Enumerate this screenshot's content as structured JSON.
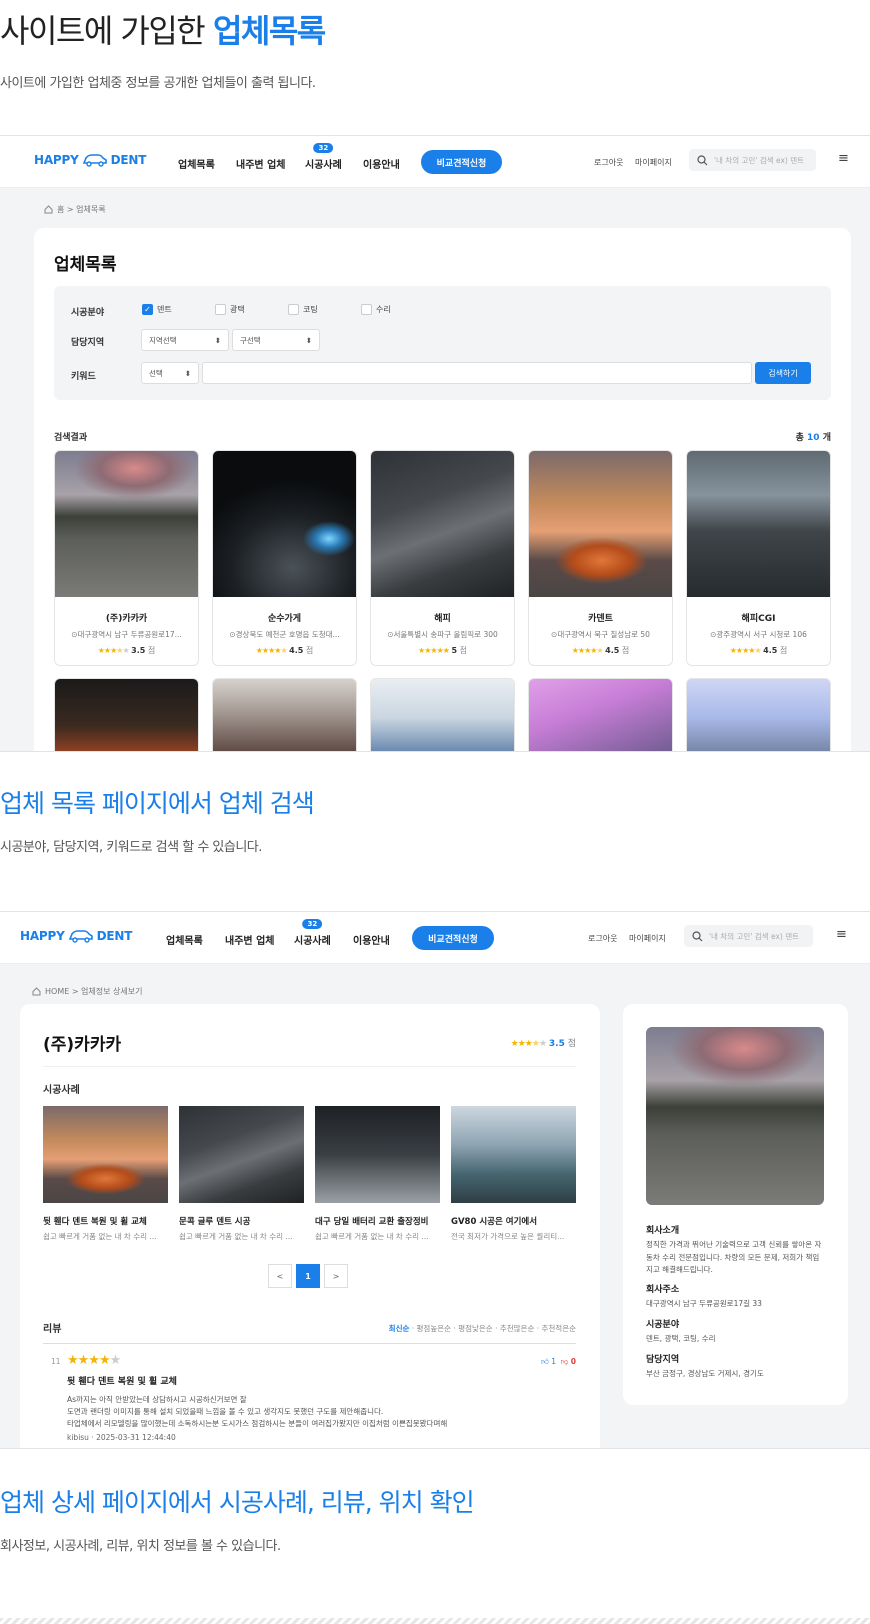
{
  "sections": [
    {
      "title_plain": "사이트에 가입한 ",
      "title_highlight": "업체목록",
      "subtitle": "사이트에 가입한 업체중 정보를 공개한 업체들이 출력 됩니다."
    },
    {
      "title": "업체 목록 페이지에서 업체 검색",
      "subtitle": "시공분야, 담당지역, 키워드로 검색 할 수 있습니다."
    },
    {
      "title": "업체 상세 페이지에서 시공사례, 리뷰, 위치 확인",
      "subtitle": "회사정보, 시공사례, 리뷰, 위치 정보를 볼 수 있습니다."
    }
  ],
  "header": {
    "logo_left": "HAPPY",
    "logo_right": "DENT",
    "nav": [
      "업체목록",
      "내주변 업체",
      "시공사례",
      "이용안내"
    ],
    "nav_badge": "32",
    "cta": "비교견적신청",
    "login": "로그아웃",
    "mypage": "마이페이지",
    "search_placeholder": "'내 차의 고민' 검색 ex) 덴트",
    "colors": {
      "accent": "#1a7fe8",
      "star": "#f5b400"
    }
  },
  "list_page": {
    "breadcrumb": "홈 > 업체목록",
    "title": "업체목록",
    "filters": {
      "field_label": "시공분야",
      "options": [
        {
          "label": "덴트",
          "checked": true
        },
        {
          "label": "광택",
          "checked": false
        },
        {
          "label": "코팅",
          "checked": false
        },
        {
          "label": "수리",
          "checked": false
        }
      ],
      "region_label": "담당지역",
      "region_select": "지역선택",
      "district_select": "구선택",
      "keyword_label": "키워드",
      "keyword_select": "선택",
      "keyword_value": "",
      "search_button": "검색하기"
    },
    "result_label": "검색결과",
    "total_prefix": "총",
    "total_count": "10",
    "total_suffix": "개",
    "companies": [
      {
        "name": "(주)카카카",
        "address": "대구광역시 남구 두류공원로17...",
        "rating": "3.5",
        "stars": "★★★",
        "half": "★",
        "off": "★",
        "unit": "점"
      },
      {
        "name": "순수가게",
        "address": "경상북도 예천군 호명읍 도청대...",
        "rating": "4.5",
        "stars": "★★★★",
        "half": "★",
        "off": "",
        "unit": "점"
      },
      {
        "name": "해피",
        "address": "서울특별시 송파구 올림픽로 300",
        "rating": "5",
        "stars": "★★★★★",
        "half": "",
        "off": "",
        "unit": "점"
      },
      {
        "name": "카덴트",
        "address": "대구광역시 북구 칠성남로 50",
        "rating": "4.5",
        "stars": "★★★★",
        "half": "★",
        "off": "",
        "unit": "점"
      },
      {
        "name": "해피CGI",
        "address": "광주광역시 서구 시청로 106",
        "rating": "4.5",
        "stars": "★★★★",
        "half": "★",
        "off": "",
        "unit": "점"
      }
    ]
  },
  "detail_page": {
    "breadcrumb": "HOME > 업체정보 상세보기",
    "company": "(주)카카카",
    "rating": "3.5",
    "rating_unit": "점",
    "cases_title": "시공사례",
    "cases": [
      {
        "title": "뒷 휀다 덴트 복원 및 휠 교체",
        "desc": "쉽고 빠르게 거품 없는 내 차 수리 ..."
      },
      {
        "title": "문콕 글루 덴트 시공",
        "desc": "쉽고 빠르게 거품 없는 내 차 수리 ..."
      },
      {
        "title": "대구 당일 배터리 교환 출장정비",
        "desc": "쉽고 빠르게 거품 없는 내 차 수리 ..."
      },
      {
        "title": "GV80 시공은 여기에서",
        "desc": "전국 최저가 가격으로 높은 퀄리티..."
      }
    ],
    "pager": {
      "prev": "<",
      "current": "1",
      "next": ">"
    },
    "reviews_title": "리뷰",
    "sort_options": [
      "최신순",
      "평점높은순",
      "평점낮은순",
      "추천많은순",
      "추천적은순"
    ],
    "review": {
      "no": "11",
      "likes": "1",
      "dislikes": "0",
      "title": "뒷 휀다 덴트 복원 및 휠 교체",
      "line1": "As까지는 아직 안받았는데 상담하시고 시공하신거보면 잘",
      "line2": "도면과 랜더링 이미지를 통해 설치 되었을때 느낌을 볼 수 있고 생각지도 못했던 구도를 제안해줍니다.",
      "line3": "타업체에서 리모델링을 많이했는데 소독하시는분 도시가스 점검하시는 분들이 여러집가봤지만 이집처럼 이쁜집못봤다며해",
      "meta": "kibisu · 2025-03-31 12:44:40"
    },
    "side": {
      "intro_h": "회사소개",
      "intro": "정직한 가격과 뛰어난 기술력으로 고객 신뢰를 쌓아온 자동차 수리 전문점입니다. 차량의 모든 문제, 저희가 책임지고 해결해드립니다.",
      "addr_h": "회사주소",
      "addr": "대구광역시 남구 두류공원로17길 33",
      "field_h": "시공분야",
      "field": "덴트, 광택, 코팅, 수리",
      "region_h": "담당지역",
      "region": "부산 금정구, 경상남도 거제시, 경기도"
    }
  }
}
